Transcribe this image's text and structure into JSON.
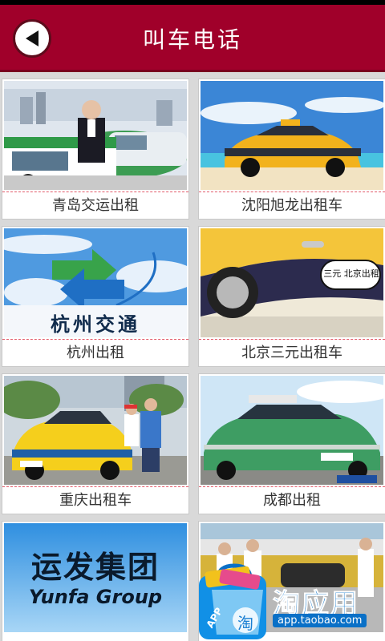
{
  "header": {
    "title": "叫车电话"
  },
  "cards": [
    {
      "label": "青岛交运出租"
    },
    {
      "label": "沈阳旭龙出租车"
    },
    {
      "label": "杭州出租",
      "logo_text": "杭州交通"
    },
    {
      "label": "北京三元出租车",
      "door_text": "三元 北京出租"
    },
    {
      "label": "重庆出租车"
    },
    {
      "label": "成都出租"
    },
    {
      "label": "",
      "logo_cn": "运发集团",
      "logo_en": "Yunfa Group"
    },
    {
      "label": ""
    }
  ],
  "app_badge": {
    "text": "淘应用",
    "url": "app.taobao.com",
    "bag_label": "APP",
    "bag_char": "淘"
  },
  "colors": {
    "titlebar": "#a0002a",
    "accent_blue": "#0a70c7"
  }
}
